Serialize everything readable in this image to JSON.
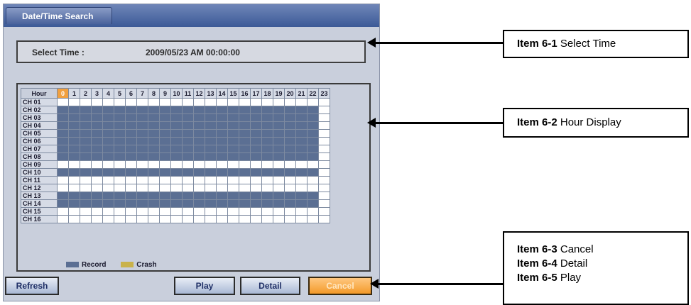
{
  "dialog": {
    "title": "Date/Time Search",
    "select_time_label": "Select Time :",
    "select_time_value": "2009/05/23 AM 00:00:00"
  },
  "grid": {
    "hour_label": "Hour",
    "hours": [
      "0",
      "1",
      "2",
      "3",
      "4",
      "5",
      "6",
      "7",
      "8",
      "9",
      "10",
      "11",
      "12",
      "13",
      "14",
      "15",
      "16",
      "17",
      "18",
      "19",
      "20",
      "21",
      "22",
      "23"
    ],
    "selected_hour": "0",
    "channels": [
      {
        "label": "CH 01",
        "recorded": false
      },
      {
        "label": "CH 02",
        "recorded": true
      },
      {
        "label": "CH 03",
        "recorded": true
      },
      {
        "label": "CH 04",
        "recorded": true
      },
      {
        "label": "CH 05",
        "recorded": true
      },
      {
        "label": "CH 06",
        "recorded": true
      },
      {
        "label": "CH 07",
        "recorded": true
      },
      {
        "label": "CH 08",
        "recorded": true
      },
      {
        "label": "CH 09",
        "recorded": false
      },
      {
        "label": "CH 10",
        "recorded": true
      },
      {
        "label": "CH 11",
        "recorded": false
      },
      {
        "label": "CH 12",
        "recorded": false
      },
      {
        "label": "CH 13",
        "recorded": true
      },
      {
        "label": "CH 14",
        "recorded": true
      },
      {
        "label": "CH 15",
        "recorded": false
      },
      {
        "label": "CH 16",
        "recorded": false
      }
    ],
    "recorded_hours_through": "22"
  },
  "legend": {
    "record_label": "Record",
    "record_color": "#5b6f93",
    "crash_label": "Crash",
    "crash_color": "#c9b24a"
  },
  "buttons": {
    "refresh": "Refresh",
    "play": "Play",
    "detail": "Detail",
    "cancel": "Cancel"
  },
  "callouts": {
    "c1": {
      "item": "Item 6-1",
      "text": "Select Time"
    },
    "c2": {
      "item": "Item 6-2",
      "text": "Hour Display"
    },
    "c3": {
      "item": "Item 6-3",
      "text": "Cancel"
    },
    "c4": {
      "item": "Item 6-4",
      "text": "Detail"
    },
    "c5": {
      "item": "Item 6-5",
      "text": "Play"
    }
  },
  "colors": {
    "accent_orange": "#f0a040",
    "record_blue": "#5b6f93"
  }
}
